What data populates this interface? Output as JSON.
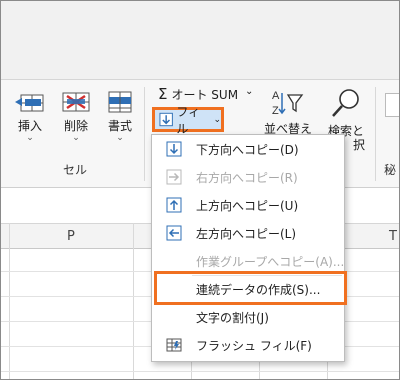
{
  "ribbon": {
    "insert_label": "挿入",
    "delete_label": "削除",
    "format_label": "書式",
    "cells_group_label": "セル",
    "autosum_label": "オート SUM",
    "fill_label": "フィル",
    "sort_label": "並べ替えと",
    "find_label": "検索と",
    "find_label2": "択",
    "sensitivity_label": "秘",
    "chevron": "⌄"
  },
  "columns": [
    "P",
    "Q",
    "R",
    "S",
    "T"
  ],
  "fill_menu": {
    "items": [
      {
        "label": "下方向へコピー(D)",
        "enabled": true,
        "icon": "arrow-down-icon"
      },
      {
        "label": "右方向へコピー(R)",
        "enabled": false,
        "icon": "arrow-right-icon"
      },
      {
        "label": "上方向へコピー(U)",
        "enabled": true,
        "icon": "arrow-up-icon"
      },
      {
        "label": "左方向へコピー(L)",
        "enabled": true,
        "icon": "arrow-left-icon"
      },
      {
        "label": "作業グループへコピー(A)...",
        "enabled": false,
        "icon": ""
      },
      {
        "label": "連続データの作成(S)...",
        "enabled": true,
        "icon": ""
      },
      {
        "label": "文字の割付(J)",
        "enabled": true,
        "icon": ""
      },
      {
        "label": "フラッシュ フィル(F)",
        "enabled": true,
        "icon": "flash-fill-icon"
      }
    ]
  },
  "colors": {
    "highlight_orange": "#f07020",
    "icon_blue": "#2f6fb5",
    "fill_button_bg": "#cfe3f7"
  }
}
